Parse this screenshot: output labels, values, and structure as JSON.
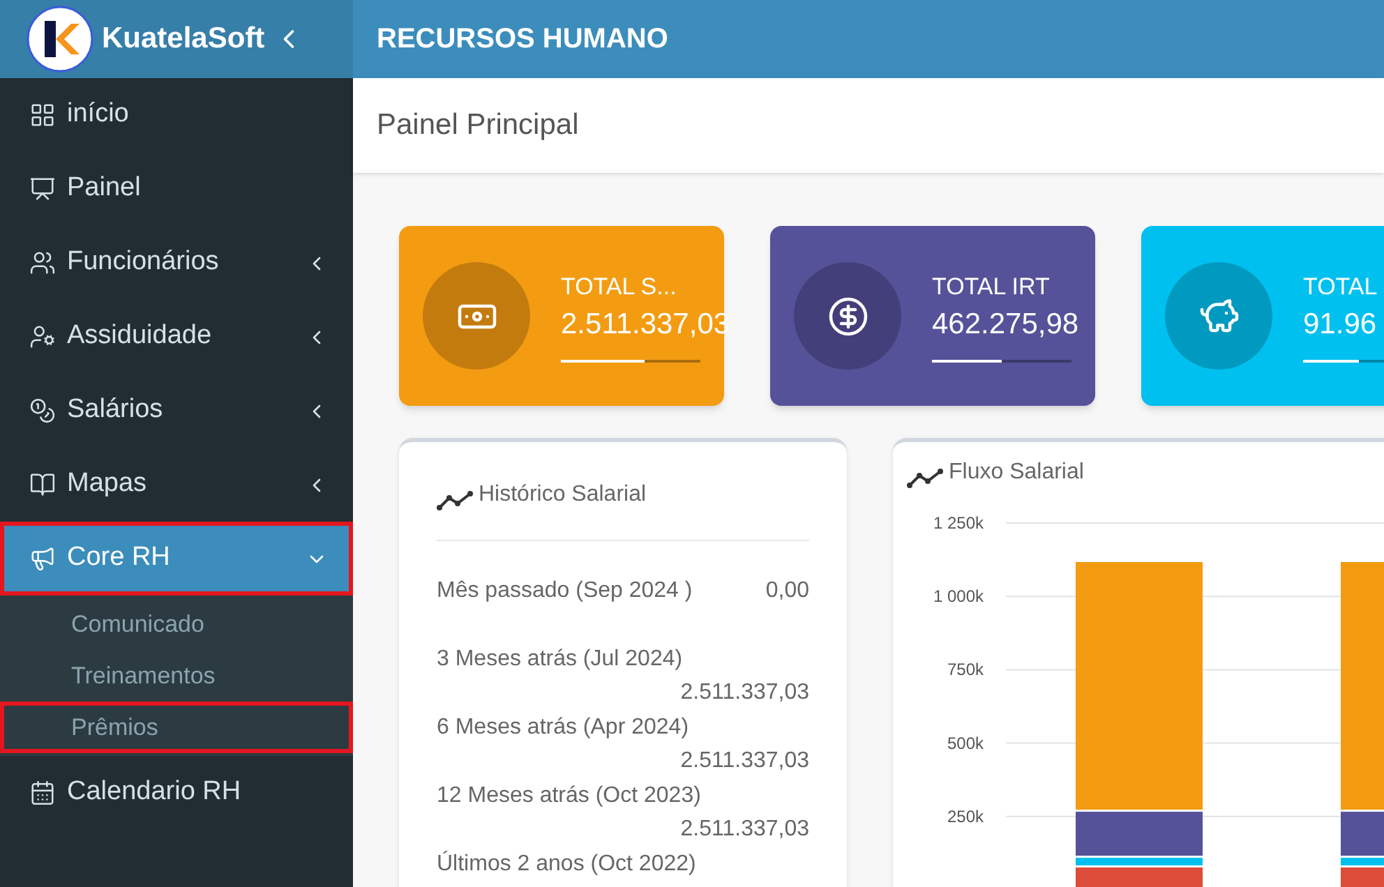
{
  "header": {
    "brand": "KuatelaSoft",
    "title": "RECURSOS HUMANO"
  },
  "sidebar": {
    "items": [
      {
        "label": "início",
        "kind": "link",
        "selected": false,
        "highlighted": false
      },
      {
        "label": "Painel",
        "kind": "link",
        "selected": false,
        "highlighted": false
      },
      {
        "label": "Funcionários",
        "kind": "group",
        "expanded": false,
        "selected": false,
        "highlighted": false
      },
      {
        "label": "Assiduidade",
        "kind": "group",
        "expanded": false,
        "selected": false,
        "highlighted": false
      },
      {
        "label": "Salários",
        "kind": "group",
        "expanded": false,
        "selected": false,
        "highlighted": false
      },
      {
        "label": "Mapas",
        "kind": "group",
        "expanded": false,
        "selected": false,
        "highlighted": false
      },
      {
        "label": "Core RH",
        "kind": "group",
        "expanded": true,
        "selected": true,
        "highlighted": true,
        "children": [
          {
            "label": "Comunicado",
            "highlighted": false
          },
          {
            "label": "Treinamentos",
            "highlighted": false
          },
          {
            "label": "Prêmios",
            "highlighted": true
          }
        ]
      },
      {
        "label": "Calendario RH",
        "kind": "link",
        "selected": false,
        "highlighted": false
      }
    ]
  },
  "page_title": "Painel Principal",
  "stat_cards": [
    {
      "title": "TOTAL S...",
      "value": "2.511.337,03",
      "level": 0.6,
      "color": "#f39c12"
    },
    {
      "title": "TOTAL IRT",
      "value": "462.275,98",
      "level": 0.5,
      "color": "#555299"
    },
    {
      "title": "TOTAL",
      "value": "91.96",
      "level": 0.4,
      "color": "#00c0ef"
    }
  ],
  "history": {
    "title": "Histórico Salarial",
    "rows": [
      {
        "label": "Mês passado (Sep 2024 )",
        "value": "0,00"
      },
      {
        "label": "3 Meses atrás (Jul 2024)",
        "value": "2.511.337,03"
      },
      {
        "label": "6 Meses atrás (Apr 2024)",
        "value": "2.511.337,03"
      },
      {
        "label": "12 Meses atrás (Oct 2023)",
        "value": "2.511.337,03"
      },
      {
        "label": "Últimos 2 anos (Oct 2022)"
      }
    ]
  },
  "flow": {
    "title": "Fluxo Salarial",
    "chart_data": {
      "type": "bar",
      "stacked": true,
      "grid": true,
      "ylim": [
        0,
        1250000
      ],
      "yticks": [
        {
          "value": 250000,
          "label": "250k"
        },
        {
          "value": 500000,
          "label": "500k"
        },
        {
          "value": 750000,
          "label": "750k"
        },
        {
          "value": 1000000,
          "label": "1 000k"
        },
        {
          "value": 1250000,
          "label": "1 250k"
        }
      ],
      "series": [
        {
          "color": "#dd4b39",
          "values": [
            76000,
            76000
          ]
        },
        {
          "color": "#00c0ef",
          "values": [
            33000,
            33000
          ]
        },
        {
          "color": "#555299",
          "values": [
            157000,
            157000
          ]
        },
        {
          "color": "#f39c12",
          "values": [
            851000,
            851000
          ]
        }
      ]
    }
  }
}
